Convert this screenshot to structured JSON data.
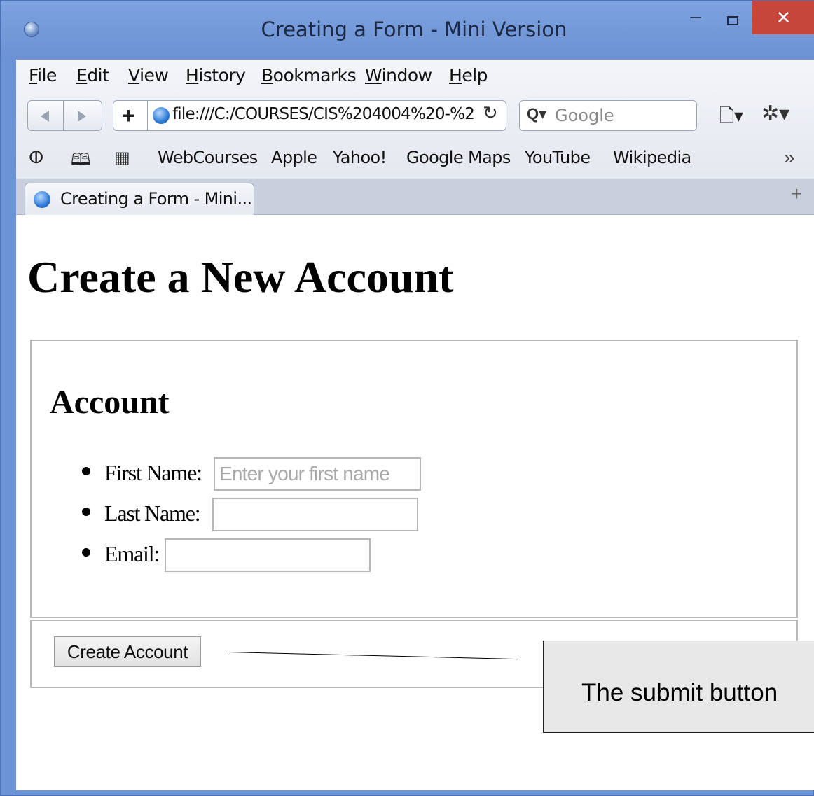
{
  "window": {
    "title": "Creating a Form - Mini Version",
    "minimize_glyph": "–",
    "close_glyph": "✕"
  },
  "menubar": {
    "items": [
      "File",
      "Edit",
      "View",
      "History",
      "Bookmarks",
      "Window",
      "Help"
    ]
  },
  "toolbar": {
    "add_bookmark_glyph": "+",
    "address": "file:///C:/COURSES/CIS%204004%20-%2",
    "reload_glyph": "↻",
    "search_icon_glyph": "Q▾",
    "search_placeholder": "Google",
    "page_menu_glyph": "🗋▾",
    "settings_glyph": "✲▾"
  },
  "bookmarks_bar": {
    "reading_list_glyph": "ⵀ",
    "bookmarks_glyph": "🕮",
    "top_sites_glyph": "▦",
    "items": [
      "WebCourses",
      "Apple",
      "Yahoo!",
      "Google Maps",
      "YouTube",
      "Wikipedia"
    ],
    "more_glyph": "»"
  },
  "tabs": {
    "active_label": "Creating a Form - Mini...",
    "new_tab_glyph": "+"
  },
  "page": {
    "heading": "Create a New Account",
    "account_legend": "Account",
    "fields": [
      {
        "label": "First Name:",
        "placeholder": "Enter your first name",
        "value": ""
      },
      {
        "label": "Last Name:",
        "placeholder": "",
        "value": ""
      },
      {
        "label": "Email:",
        "placeholder": "",
        "value": ""
      }
    ],
    "submit_label": "Create Account"
  },
  "annotation": {
    "callout_text": "The submit button"
  },
  "colors": {
    "window_frame": "#6b93d6",
    "close_button": "#c7463b",
    "callout_fill": "#e8e8e8"
  }
}
